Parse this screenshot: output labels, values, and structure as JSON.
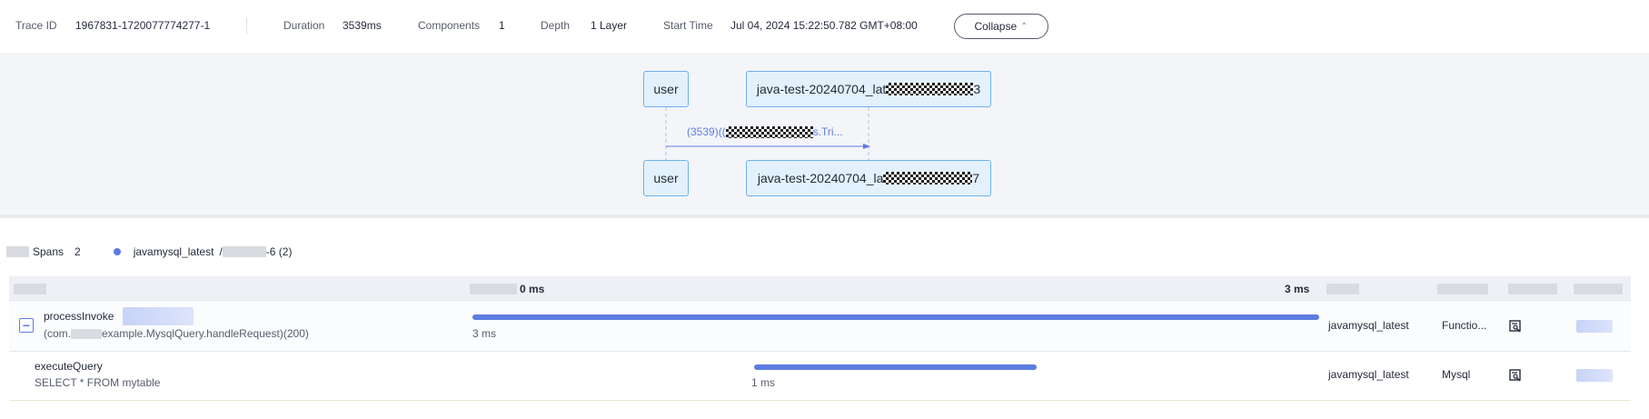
{
  "header": {
    "trace_id_label": "Trace ID",
    "trace_id_value": "1967831-1720077774277-1",
    "duration_label": "Duration",
    "duration_value": "3539ms",
    "components_label": "Components",
    "components_value": "1",
    "depth_label": "Depth",
    "depth_value": "1 Layer",
    "start_time_label": "Start Time",
    "start_time_value": "Jul 04, 2024 15:22:50.782 GMT+08:00",
    "collapse_label": "Collapse"
  },
  "diagram": {
    "caller_top": "user",
    "caller_bottom": "user",
    "callee_top_prefix": "java-test-20240704_lat",
    "callee_top_suffix": "3",
    "callee_bottom_prefix": "java-test-20240704_la",
    "callee_bottom_suffix": "7",
    "message_prefix": "(3539)((",
    "message_suffix": "s.Tri..."
  },
  "spans_summary": {
    "spans_label": "Spans",
    "spans_count": "2",
    "service_name": "javamysql_latest",
    "service_suffix": "-6 (2)"
  },
  "table": {
    "timeline_start": "0 ms",
    "timeline_end": "3 ms",
    "rows": [
      {
        "name": "processInvoke",
        "detail_prefix": "(com.",
        "detail_suffix": "example.MysqlQuery.handleRequest)(200)",
        "duration": "3 ms",
        "bar_start": 0.0,
        "bar_fraction": 1.0,
        "app": "javamysql_latest",
        "type": "Functio..."
      },
      {
        "name": "executeQuery",
        "detail": "SELECT * FROM mytable",
        "duration": "1 ms",
        "bar_start": 0.333,
        "bar_fraction": 0.333,
        "app": "javamysql_latest",
        "type": "Mysql"
      }
    ]
  },
  "colors": {
    "accent": "#5e7ce0",
    "actor_fill": "#e3f1fd",
    "actor_border": "#6fb1ee"
  }
}
